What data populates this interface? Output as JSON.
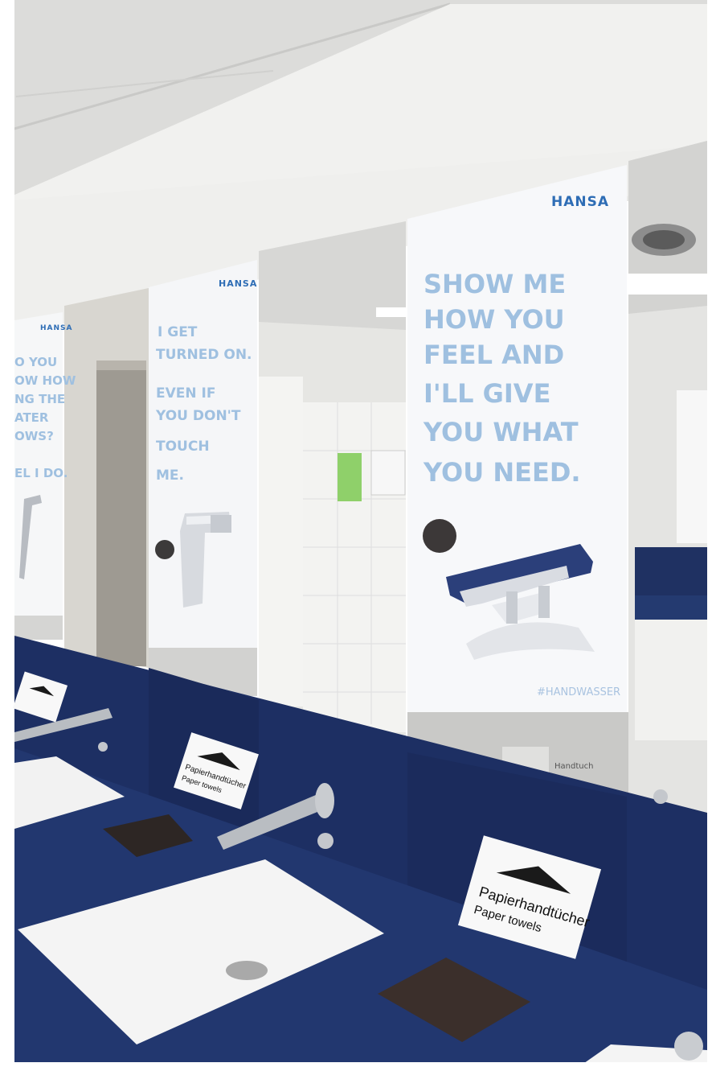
{
  "brand": "HANSA",
  "posters": {
    "center": [
      "SHOW ME",
      "HOW YOU",
      "FEEL AND",
      "I'LL GIVE",
      "YOU WHAT",
      "YOU NEED."
    ],
    "center_hashtag": "#HANDWASSER",
    "middle": [
      "I GET",
      "TURNED ON.",
      "EVEN IF",
      "YOU DON'T",
      "TOUCH",
      "ME."
    ],
    "left": [
      "O YOU",
      "OW HOW",
      "NG THE",
      "ATER",
      "OWS?",
      "EL I DO."
    ]
  },
  "signs": {
    "de": "Papierhandtücher",
    "en": "Paper towels"
  },
  "dryer_label": "Handtuch",
  "colors": {
    "counter": "#1d2f63",
    "poster_text": "#9fc0e0",
    "brand": "#2e6db5"
  }
}
